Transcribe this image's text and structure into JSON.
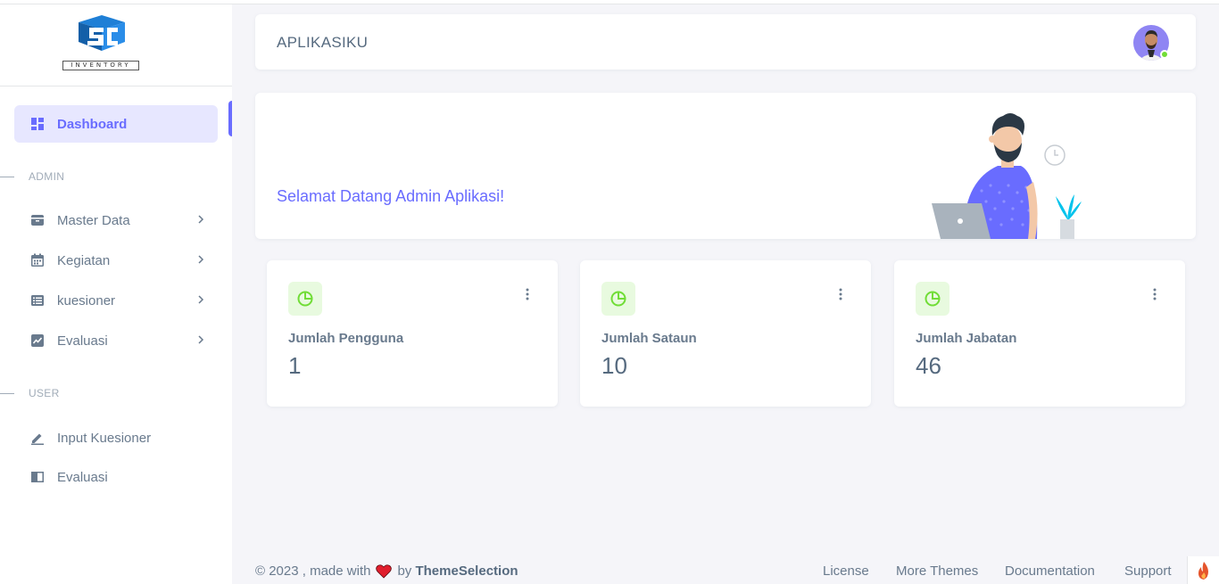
{
  "brand": {
    "text": "INVENTORY"
  },
  "sidebar": {
    "dashboard": "Dashboard",
    "header_admin": "ADMIN",
    "admin_items": [
      {
        "label": "Master Data",
        "icon": "archive-icon"
      },
      {
        "label": "Kegiatan",
        "icon": "calendar-icon"
      },
      {
        "label": "kuesioner",
        "icon": "list-icon"
      },
      {
        "label": "Evaluasi",
        "icon": "chart-icon"
      }
    ],
    "header_user": "USER",
    "user_items": [
      {
        "label": "Input Kuesioner",
        "icon": "pencil-icon"
      },
      {
        "label": "Evaluasi",
        "icon": "book-icon"
      }
    ]
  },
  "navbar": {
    "title": "APLIKASIKU"
  },
  "welcome": {
    "title": "Selamat Datang Admin Aplikasi!"
  },
  "stats": [
    {
      "label": "Jumlah Pengguna",
      "value": "1"
    },
    {
      "label": "Jumlah Sataun",
      "value": "10"
    },
    {
      "label": "Jumlah Jabatan",
      "value": "46"
    }
  ],
  "footer": {
    "prefix": "© 2023 , made with",
    "by": "by",
    "brand": "ThemeSelection",
    "links": [
      "License",
      "More Themes",
      "Documentation",
      "Support"
    ]
  },
  "colors": {
    "primary": "#696cff",
    "success": "#71dd37",
    "heart": "#e01e2d"
  }
}
